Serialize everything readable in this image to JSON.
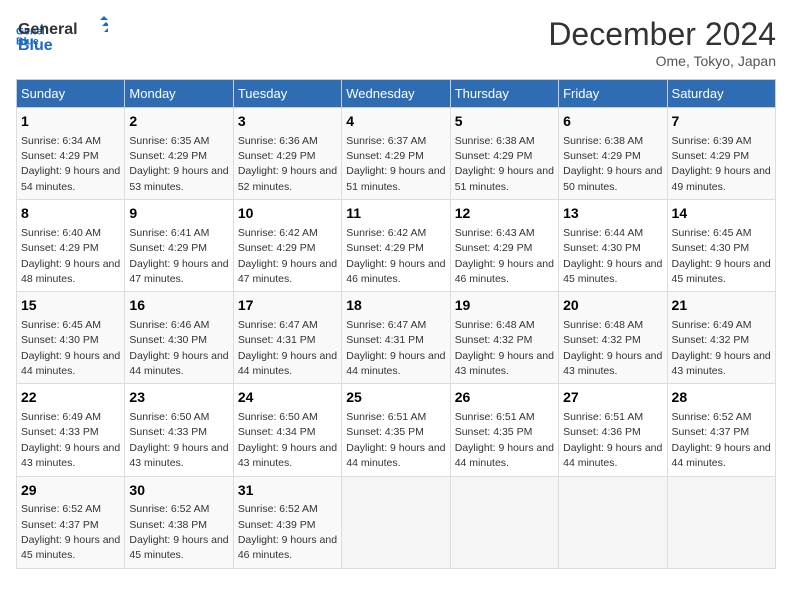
{
  "header": {
    "logo_line1": "General",
    "logo_line2": "Blue",
    "month": "December 2024",
    "location": "Ome, Tokyo, Japan"
  },
  "weekdays": [
    "Sunday",
    "Monday",
    "Tuesday",
    "Wednesday",
    "Thursday",
    "Friday",
    "Saturday"
  ],
  "weeks": [
    [
      {
        "day": "1",
        "sunrise": "6:34 AM",
        "sunset": "4:29 PM",
        "daylight": "9 hours and 54 minutes."
      },
      {
        "day": "2",
        "sunrise": "6:35 AM",
        "sunset": "4:29 PM",
        "daylight": "9 hours and 53 minutes."
      },
      {
        "day": "3",
        "sunrise": "6:36 AM",
        "sunset": "4:29 PM",
        "daylight": "9 hours and 52 minutes."
      },
      {
        "day": "4",
        "sunrise": "6:37 AM",
        "sunset": "4:29 PM",
        "daylight": "9 hours and 51 minutes."
      },
      {
        "day": "5",
        "sunrise": "6:38 AM",
        "sunset": "4:29 PM",
        "daylight": "9 hours and 51 minutes."
      },
      {
        "day": "6",
        "sunrise": "6:38 AM",
        "sunset": "4:29 PM",
        "daylight": "9 hours and 50 minutes."
      },
      {
        "day": "7",
        "sunrise": "6:39 AM",
        "sunset": "4:29 PM",
        "daylight": "9 hours and 49 minutes."
      }
    ],
    [
      {
        "day": "8",
        "sunrise": "6:40 AM",
        "sunset": "4:29 PM",
        "daylight": "9 hours and 48 minutes."
      },
      {
        "day": "9",
        "sunrise": "6:41 AM",
        "sunset": "4:29 PM",
        "daylight": "9 hours and 47 minutes."
      },
      {
        "day": "10",
        "sunrise": "6:42 AM",
        "sunset": "4:29 PM",
        "daylight": "9 hours and 47 minutes."
      },
      {
        "day": "11",
        "sunrise": "6:42 AM",
        "sunset": "4:29 PM",
        "daylight": "9 hours and 46 minutes."
      },
      {
        "day": "12",
        "sunrise": "6:43 AM",
        "sunset": "4:29 PM",
        "daylight": "9 hours and 46 minutes."
      },
      {
        "day": "13",
        "sunrise": "6:44 AM",
        "sunset": "4:30 PM",
        "daylight": "9 hours and 45 minutes."
      },
      {
        "day": "14",
        "sunrise": "6:45 AM",
        "sunset": "4:30 PM",
        "daylight": "9 hours and 45 minutes."
      }
    ],
    [
      {
        "day": "15",
        "sunrise": "6:45 AM",
        "sunset": "4:30 PM",
        "daylight": "9 hours and 44 minutes."
      },
      {
        "day": "16",
        "sunrise": "6:46 AM",
        "sunset": "4:30 PM",
        "daylight": "9 hours and 44 minutes."
      },
      {
        "day": "17",
        "sunrise": "6:47 AM",
        "sunset": "4:31 PM",
        "daylight": "9 hours and 44 minutes."
      },
      {
        "day": "18",
        "sunrise": "6:47 AM",
        "sunset": "4:31 PM",
        "daylight": "9 hours and 44 minutes."
      },
      {
        "day": "19",
        "sunrise": "6:48 AM",
        "sunset": "4:32 PM",
        "daylight": "9 hours and 43 minutes."
      },
      {
        "day": "20",
        "sunrise": "6:48 AM",
        "sunset": "4:32 PM",
        "daylight": "9 hours and 43 minutes."
      },
      {
        "day": "21",
        "sunrise": "6:49 AM",
        "sunset": "4:32 PM",
        "daylight": "9 hours and 43 minutes."
      }
    ],
    [
      {
        "day": "22",
        "sunrise": "6:49 AM",
        "sunset": "4:33 PM",
        "daylight": "9 hours and 43 minutes."
      },
      {
        "day": "23",
        "sunrise": "6:50 AM",
        "sunset": "4:33 PM",
        "daylight": "9 hours and 43 minutes."
      },
      {
        "day": "24",
        "sunrise": "6:50 AM",
        "sunset": "4:34 PM",
        "daylight": "9 hours and 43 minutes."
      },
      {
        "day": "25",
        "sunrise": "6:51 AM",
        "sunset": "4:35 PM",
        "daylight": "9 hours and 44 minutes."
      },
      {
        "day": "26",
        "sunrise": "6:51 AM",
        "sunset": "4:35 PM",
        "daylight": "9 hours and 44 minutes."
      },
      {
        "day": "27",
        "sunrise": "6:51 AM",
        "sunset": "4:36 PM",
        "daylight": "9 hours and 44 minutes."
      },
      {
        "day": "28",
        "sunrise": "6:52 AM",
        "sunset": "4:37 PM",
        "daylight": "9 hours and 44 minutes."
      }
    ],
    [
      {
        "day": "29",
        "sunrise": "6:52 AM",
        "sunset": "4:37 PM",
        "daylight": "9 hours and 45 minutes."
      },
      {
        "day": "30",
        "sunrise": "6:52 AM",
        "sunset": "4:38 PM",
        "daylight": "9 hours and 45 minutes."
      },
      {
        "day": "31",
        "sunrise": "6:52 AM",
        "sunset": "4:39 PM",
        "daylight": "9 hours and 46 minutes."
      },
      null,
      null,
      null,
      null
    ]
  ]
}
